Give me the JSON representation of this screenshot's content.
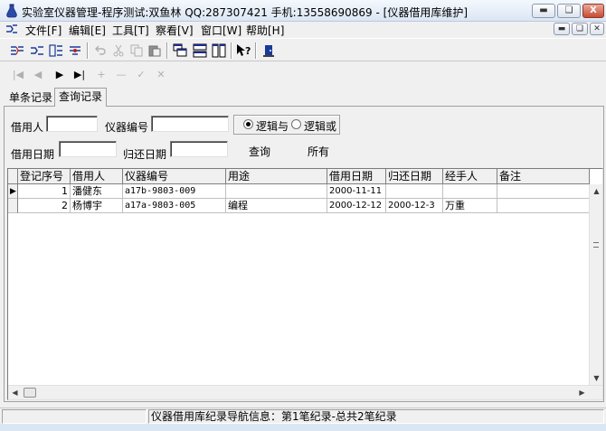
{
  "window": {
    "title": "实验室仪器管理-程序测试:双鱼林  QQ:287307421 手机:13558690869 - [仪器借用库维护]",
    "minimize_icon": "minimize-icon",
    "restore_icon": "restore-icon",
    "close_label": "X"
  },
  "menu": {
    "items": [
      {
        "label": "文件[F]"
      },
      {
        "label": "编辑[E]"
      },
      {
        "label": "工具[T]"
      },
      {
        "label": "察看[V]"
      },
      {
        "label": "窗口[W]"
      },
      {
        "label": "帮助[H]"
      }
    ]
  },
  "tabs": [
    {
      "label": "单条记录",
      "active": false
    },
    {
      "label": "查询记录",
      "active": true
    }
  ],
  "filters": {
    "borrower_label": "借用人",
    "borrower_value": "",
    "instrument_no_label": "仪器编号",
    "instrument_no_value": "",
    "borrow_date_label": "借用日期",
    "borrow_date_value": "",
    "return_date_label": "归还日期",
    "return_date_value": "",
    "logic_and_label": "逻辑与",
    "logic_or_label": "逻辑或",
    "logic_selected": "and",
    "query_label": "查询",
    "all_label": "所有"
  },
  "grid": {
    "columns": [
      "登记序号",
      "借用人",
      "仪器编号",
      "用途",
      "借用日期",
      "归还日期",
      "经手人",
      "备注"
    ],
    "rows": [
      {
        "id": "1",
        "borrower": "潘健东",
        "instrument_no": "a17b-9803-009",
        "purpose": "",
        "borrow_date": "2000-11-11",
        "return_date": "",
        "handler": "",
        "remark": ""
      },
      {
        "id": "2",
        "borrower": "杨博宇",
        "instrument_no": "a17a-9803-005",
        "purpose": "编程",
        "borrow_date": "2000-12-12",
        "return_date": "2000-12-3",
        "handler": "万重",
        "remark": ""
      }
    ]
  },
  "status": {
    "message": "仪器借用库纪录导航信息：第1笔纪录-总共2笔纪录"
  }
}
